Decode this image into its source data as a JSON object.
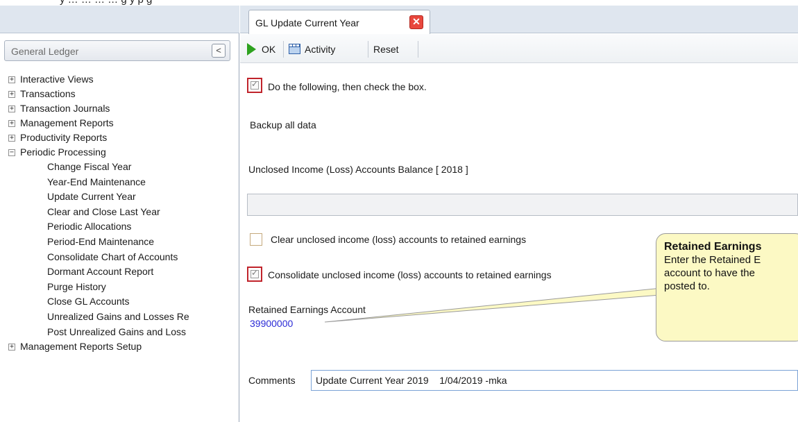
{
  "doc_header": {
    "text_before": "y … … … … g y ",
    "link_text": "",
    "text_after": " p g"
  },
  "left_panel": {
    "title": "General Ledger",
    "collapse_glyph": "<",
    "tree": [
      {
        "label": "Interactive Views",
        "expander": "+"
      },
      {
        "label": "Transactions",
        "expander": "+"
      },
      {
        "label": "Transaction Journals",
        "expander": "+"
      },
      {
        "label": "Management Reports",
        "expander": "+"
      },
      {
        "label": "Productivity Reports",
        "expander": "+"
      },
      {
        "label": "Periodic Processing",
        "expander": "−"
      }
    ],
    "periodic_children": [
      "Change Fiscal Year",
      "Year-End Maintenance",
      "Update Current Year",
      "Clear and Close Last Year",
      "Periodic Allocations",
      "Period-End Maintenance",
      "Consolidate Chart of Accounts",
      "Dormant Account Report",
      "Purge History",
      "Close GL Accounts",
      "Unrealized Gains and Losses Re",
      "Post Unrealized Gains and Loss"
    ],
    "tree_after": {
      "label": "Management Reports Setup",
      "expander": "+"
    }
  },
  "tab": {
    "label": "GL Update Current Year",
    "close_glyph": "✕"
  },
  "toolbar": {
    "ok_label": "OK",
    "activity_label": "Activity",
    "reset_label": "Reset"
  },
  "form": {
    "instruction_label": "Do the following, then check the box.",
    "instruction_checked": true,
    "backup_text": "Backup all data",
    "balance_label": "Unclosed Income (Loss) Accounts Balance [ 2018 ]",
    "balance_value": "",
    "clear_label": "Clear unclosed income (loss) accounts to retained earnings",
    "clear_checked": false,
    "consolidate_label": "Consolidate unclosed income (loss) accounts to retained earnings",
    "consolidate_checked": true,
    "retained_label": "Retained Earnings Account",
    "retained_value": "39900000",
    "lookup_glyph": "···",
    "comments_label": "Comments",
    "comments_value": "Update Current Year 2019    1/04/2019 -mka"
  },
  "callout": {
    "title": "Retained Earnings",
    "lines": [
      "Enter the Retained E",
      "account to have the",
      "posted to."
    ]
  },
  "colors": {
    "accent_red": "#c0232b",
    "link_blue": "#2b2bd6",
    "callout_bg": "#fcf9c4",
    "ok_green": "#2ea21f"
  }
}
